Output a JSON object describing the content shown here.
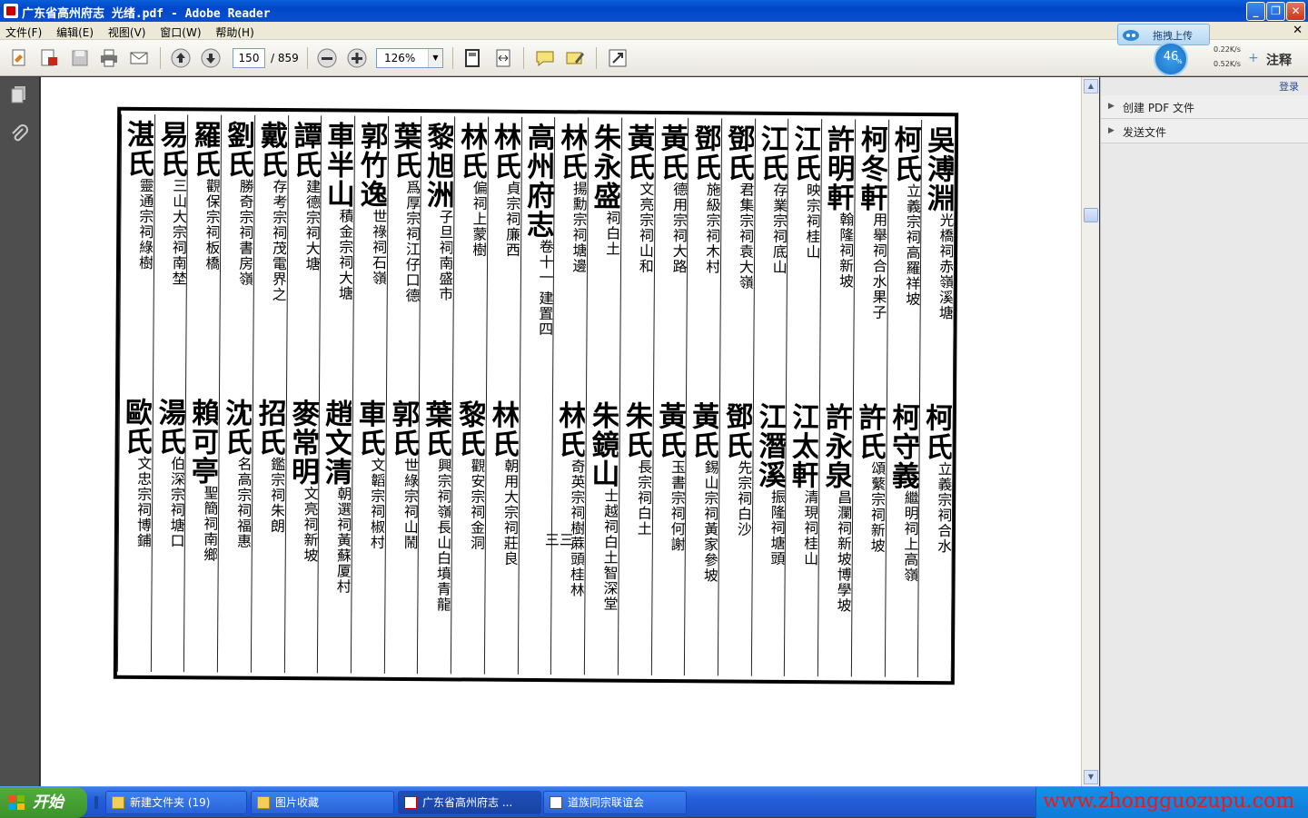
{
  "window": {
    "title": "广东省高州府志 光绪.pdf - Adobe Reader"
  },
  "menu": {
    "items": [
      "文件(F)",
      "编辑(E)",
      "视图(V)",
      "窗口(W)",
      "帮助(H)"
    ],
    "close_glyph": "✕"
  },
  "toolbar": {
    "page_current": "150",
    "page_total": "/ 859",
    "zoom": "126%"
  },
  "upload": {
    "label": "拖拽上传",
    "percent": "46",
    "percent_sign": "%",
    "up_speed": "0.22K/s",
    "down_speed": "0.52K/s",
    "annotate_label": "注释"
  },
  "right_pane": {
    "login": "登录",
    "sections": [
      "创建 PDF 文件",
      "发送文件"
    ]
  },
  "document": {
    "page_number_mark": "三三",
    "columns_top": [
      {
        "big": "吳溥淵",
        "small": "光橋祠赤嶺溪塘"
      },
      {
        "big": "柯氏",
        "small": "立義宗祠高羅祥坡"
      },
      {
        "big": "柯冬軒",
        "small": "用舉祠合水果子"
      },
      {
        "big": "許明軒",
        "small": "翰隆祠新坡"
      },
      {
        "big": "江氏",
        "small": "映宗祠桂山"
      },
      {
        "big": "江氏",
        "small": "存業宗祠底山"
      },
      {
        "big": "鄧氏",
        "small": "君集宗祠袁大嶺"
      },
      {
        "big": "鄧氏",
        "small": "施級宗祠木村"
      },
      {
        "big": "黃氏",
        "small": "德用宗祠大路"
      },
      {
        "big": "黃氏",
        "small": "文亮宗祠山和"
      },
      {
        "big": "朱永盛",
        "small": "祠白土"
      },
      {
        "big": "林氏",
        "small": "揚勳宗祠塘邊"
      },
      {
        "big": "高州府志",
        "small": "卷十一 建置四"
      },
      {
        "big": "林氏",
        "small": "貞宗祠廉西"
      },
      {
        "big": "林氏",
        "small": "偏祠上蒙樹"
      },
      {
        "big": "黎旭洲",
        "small": "子旦祠南盛市"
      },
      {
        "big": "葉氏",
        "small": "爲厚宗祠江仔口德"
      },
      {
        "big": "郭竹逸",
        "small": "世祿祠石嶺"
      },
      {
        "big": "車半山",
        "small": "積金宗祠大塘"
      },
      {
        "big": "譚氏",
        "small": "建德宗祠大塘"
      },
      {
        "big": "戴氏",
        "small": "存考宗祠茂電界之"
      },
      {
        "big": "劉氏",
        "small": "勝奇宗祠書房嶺"
      },
      {
        "big": "羅氏",
        "small": "觀保宗祠板橋"
      },
      {
        "big": "易氏",
        "small": "三山大宗祠南埜"
      },
      {
        "big": "湛氏",
        "small": "靈通宗祠綠樹"
      }
    ],
    "columns_bottom": [
      {
        "big": "柯氏",
        "small": "立義宗祠合水"
      },
      {
        "big": "柯守義",
        "small": "繼明祠上高嶺"
      },
      {
        "big": "許氏",
        "small": "頌蘩宗祠新坡"
      },
      {
        "big": "許永泉",
        "small": "昌瀾祠新坡博學坡"
      },
      {
        "big": "江太軒",
        "small": "清現祠桂山"
      },
      {
        "big": "江潛溪",
        "small": "振隆祠塘頭"
      },
      {
        "big": "鄧氏",
        "small": "先宗祠白沙"
      },
      {
        "big": "黃氏",
        "small": "錫山宗祠黃家參坡"
      },
      {
        "big": "黃氏",
        "small": "玉書宗祠何謝"
      },
      {
        "big": "朱氏",
        "small": "長宗祠白土"
      },
      {
        "big": "朱鏡山",
        "small": "士越祠白土智深堂"
      },
      {
        "big": "林氏",
        "small": "奇英宗祠樹蔴頭桂林"
      },
      {
        "big": "",
        "small": ""
      },
      {
        "big": "林氏",
        "small": "朝用大宗祠莊良"
      },
      {
        "big": "黎氏",
        "small": "觀安宗祠金洞"
      },
      {
        "big": "葉氏",
        "small": "興宗祠嶺長山白墳青龍"
      },
      {
        "big": "郭氏",
        "small": "世綠宗祠山鬧"
      },
      {
        "big": "車氏",
        "small": "文韜宗祠椒村"
      },
      {
        "big": "趙文清",
        "small": "朝選祠黃蘇厦村"
      },
      {
        "big": "麥常明",
        "small": "文亮祠新坡"
      },
      {
        "big": "招氏",
        "small": "鑑宗祠朱朗"
      },
      {
        "big": "沈氏",
        "small": "名高宗祠福惠"
      },
      {
        "big": "賴可亭",
        "small": "聖簡祠南鄉"
      },
      {
        "big": "湯氏",
        "small": "伯深宗祠塘口"
      },
      {
        "big": "歐氏",
        "small": "文忠宗祠博鋪"
      }
    ]
  },
  "taskbar": {
    "start_label": "开始",
    "tasks": [
      "新建文件夹 (19)",
      "图片收藏",
      "广东省高州府志 ...",
      "道族同宗联谊会"
    ]
  },
  "watermark": "www.zhongguozupu.com",
  "colors": {
    "title_bar": "#0a50d0",
    "taskbar": "#245edb",
    "start": "#3c922c",
    "watermark": "#e81a1a"
  }
}
